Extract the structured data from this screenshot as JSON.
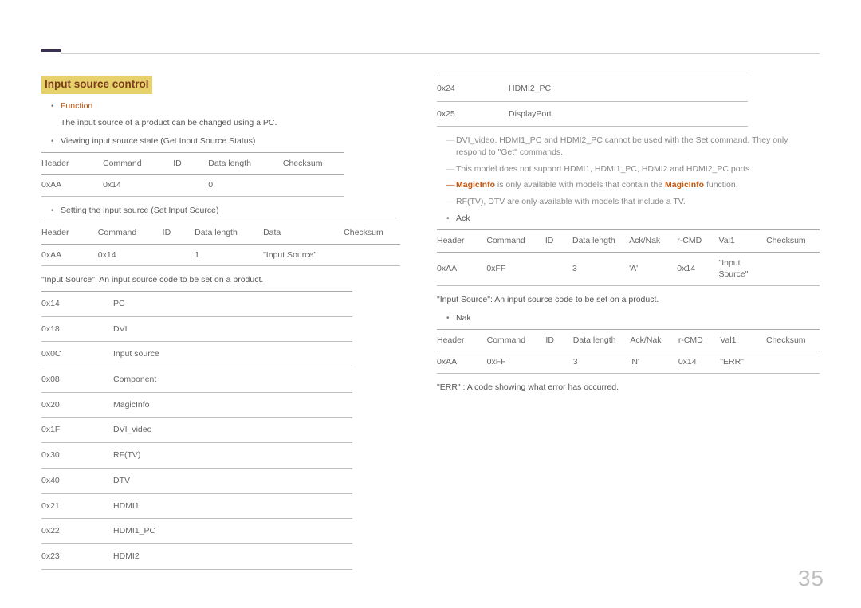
{
  "page_number": "35",
  "title": "Input source control",
  "left": {
    "b_function": "Function",
    "function_desc": "The input source of a product can be changed using a PC.",
    "b_viewing": "Viewing input source state (Get Input Source Status)",
    "table_view": {
      "h1": "Header",
      "h2": "Command",
      "h3": "ID",
      "h4": "Data length",
      "h5": "Checksum",
      "r1c1": "0xAA",
      "r1c2": "0x14",
      "r1c3": "",
      "r1c4": "0",
      "r1c5": ""
    },
    "b_setting": "Setting the input source (Set Input Source)",
    "table_set": {
      "h1": "Header",
      "h2": "Command",
      "h3": "ID",
      "h4": "Data length",
      "h5": "Data",
      "h6": "Checksum",
      "r1c1": "0xAA",
      "r1c2": "0x14",
      "r1c3": "",
      "r1c4": "1",
      "r1c5": "\"Input Source\"",
      "r1c6": ""
    },
    "desc_input_source": "\"Input Source\": An input source code to be set on a product.",
    "codes": [
      {
        "c": "0x14",
        "n": "PC"
      },
      {
        "c": "0x18",
        "n": "DVI"
      },
      {
        "c": "0x0C",
        "n": "Input source"
      },
      {
        "c": "0x08",
        "n": "Component"
      },
      {
        "c": "0x20",
        "n": "MagicInfo"
      },
      {
        "c": "0x1F",
        "n": "DVI_video"
      },
      {
        "c": "0x30",
        "n": "RF(TV)"
      },
      {
        "c": "0x40",
        "n": "DTV"
      },
      {
        "c": "0x21",
        "n": "HDMI1"
      },
      {
        "c": "0x22",
        "n": "HDMI1_PC"
      },
      {
        "c": "0x23",
        "n": "HDMI2"
      }
    ]
  },
  "right": {
    "codes_top": [
      {
        "c": "0x24",
        "n": "HDMI2_PC"
      },
      {
        "c": "0x25",
        "n": "DisplayPort"
      }
    ],
    "note1": "DVI_video, HDMI1_PC and HDMI2_PC cannot be used with the Set command. They only respond to \"Get\" commands.",
    "note2": "This model does not support HDMI1, HDMI1_PC, HDMI2 and HDMI2_PC ports.",
    "note3_a": "MagicInfo",
    "note3_b": " is only available with models that contain the ",
    "note3_c": "MagicInfo",
    "note3_d": " function.",
    "note4": "RF(TV), DTV are only available with models that include a TV.",
    "b_ack": "Ack",
    "ack_table": {
      "h1": "Header",
      "h2": "Command",
      "h3": "ID",
      "h4": "Data length",
      "h5": "Ack/Nak",
      "h6": "r-CMD",
      "h7": "Val1",
      "h8": "Checksum",
      "r1c1": "0xAA",
      "r1c2": "0xFF",
      "r1c3": "",
      "r1c4": "3",
      "r1c5": "'A'",
      "r1c6": "0x14",
      "r1c7": "\"Input Source\"",
      "r1c8": ""
    },
    "desc2": "\"Input Source\": An input source code to be set on a product.",
    "b_nak": "Nak",
    "nak_table": {
      "h1": "Header",
      "h2": "Command",
      "h3": "ID",
      "h4": "Data length",
      "h5": "Ack/Nak",
      "h6": "r-CMD",
      "h7": "Val1",
      "h8": "Checksum",
      "r1c1": "0xAA",
      "r1c2": "0xFF",
      "r1c3": "",
      "r1c4": "3",
      "r1c5": "'N'",
      "r1c6": "0x14",
      "r1c7": "\"ERR\"",
      "r1c8": ""
    },
    "err_note": "\"ERR\" : A code showing what error has occurred."
  }
}
